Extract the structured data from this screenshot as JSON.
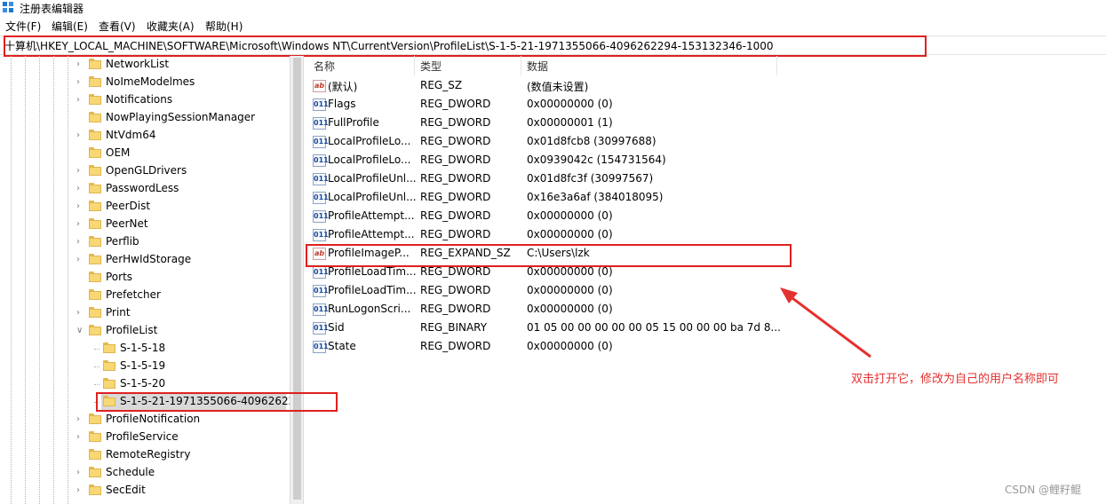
{
  "window": {
    "title": "注册表编辑器",
    "icon": "regedit-icon"
  },
  "menu": [
    "文件(F)",
    "编辑(E)",
    "查看(V)",
    "收藏夹(A)",
    "帮助(H)"
  ],
  "address": {
    "path": "十算机\\HKEY_LOCAL_MACHINE\\SOFTWARE\\Microsoft\\Windows NT\\CurrentVersion\\ProfileList\\S-1-5-21-1971355066-4096262294-153132346-1000"
  },
  "tree": {
    "items": [
      {
        "label": "NetworkList",
        "expandable": true
      },
      {
        "label": "NoImeModelmes",
        "expandable": true
      },
      {
        "label": "Notifications",
        "expandable": true
      },
      {
        "label": "NowPlayingSessionManager",
        "expandable": false
      },
      {
        "label": "NtVdm64",
        "expandable": true
      },
      {
        "label": "OEM",
        "expandable": false
      },
      {
        "label": "OpenGLDrivers",
        "expandable": true
      },
      {
        "label": "PasswordLess",
        "expandable": true
      },
      {
        "label": "PeerDist",
        "expandable": true
      },
      {
        "label": "PeerNet",
        "expandable": true
      },
      {
        "label": "Perflib",
        "expandable": true
      },
      {
        "label": "PerHwIdStorage",
        "expandable": true
      },
      {
        "label": "Ports",
        "expandable": false
      },
      {
        "label": "Prefetcher",
        "expandable": false
      },
      {
        "label": "Print",
        "expandable": true
      },
      {
        "label": "ProfileList",
        "expandable": true,
        "expanded": true
      },
      {
        "label": "S-1-5-18",
        "child": true
      },
      {
        "label": "S-1-5-19",
        "child": true
      },
      {
        "label": "S-1-5-20",
        "child": true
      },
      {
        "label": "S-1-5-21-1971355066-40962622",
        "child": true,
        "selected": true
      },
      {
        "label": "ProfileNotification",
        "expandable": true
      },
      {
        "label": "ProfileService",
        "expandable": true
      },
      {
        "label": "RemoteRegistry",
        "expandable": false
      },
      {
        "label": "Schedule",
        "expandable": true
      },
      {
        "label": "SecEdit",
        "expandable": true
      }
    ]
  },
  "list": {
    "columns": [
      "名称",
      "类型",
      "数据"
    ],
    "rows": [
      {
        "icon": "string-value-icon",
        "name": "(默认)",
        "type": "REG_SZ",
        "data": "(数值未设置)"
      },
      {
        "icon": "binary-value-icon",
        "name": "Flags",
        "type": "REG_DWORD",
        "data": "0x00000000 (0)"
      },
      {
        "icon": "binary-value-icon",
        "name": "FullProfile",
        "type": "REG_DWORD",
        "data": "0x00000001 (1)"
      },
      {
        "icon": "binary-value-icon",
        "name": "LocalProfileLo...",
        "type": "REG_DWORD",
        "data": "0x01d8fcb8 (30997688)"
      },
      {
        "icon": "binary-value-icon",
        "name": "LocalProfileLo...",
        "type": "REG_DWORD",
        "data": "0x0939042c (154731564)"
      },
      {
        "icon": "binary-value-icon",
        "name": "LocalProfileUnl...",
        "type": "REG_DWORD",
        "data": "0x01d8fc3f (30997567)"
      },
      {
        "icon": "binary-value-icon",
        "name": "LocalProfileUnl...",
        "type": "REG_DWORD",
        "data": "0x16e3a6af (384018095)"
      },
      {
        "icon": "binary-value-icon",
        "name": "ProfileAttempt...",
        "type": "REG_DWORD",
        "data": "0x00000000 (0)"
      },
      {
        "icon": "binary-value-icon",
        "name": "ProfileAttempt...",
        "type": "REG_DWORD",
        "data": "0x00000000 (0)"
      },
      {
        "icon": "string-value-icon",
        "name": "ProfileImageP...",
        "type": "REG_EXPAND_SZ",
        "data": "C:\\Users\\lzk"
      },
      {
        "icon": "binary-value-icon",
        "name": "ProfileLoadTim...",
        "type": "REG_DWORD",
        "data": "0x00000000 (0)"
      },
      {
        "icon": "binary-value-icon",
        "name": "ProfileLoadTim...",
        "type": "REG_DWORD",
        "data": "0x00000000 (0)"
      },
      {
        "icon": "binary-value-icon",
        "name": "RunLogonScri...",
        "type": "REG_DWORD",
        "data": "0x00000000 (0)"
      },
      {
        "icon": "binary-value-icon",
        "name": "Sid",
        "type": "REG_BINARY",
        "data": "01 05 00 00 00 00 00 05 15 00 00 00 ba 7d 8..."
      },
      {
        "icon": "binary-value-icon",
        "name": "State",
        "type": "REG_DWORD",
        "data": "0x00000000 (0)"
      }
    ]
  },
  "annotation": {
    "text": "双击打开它，修改为自己的用户名称即可",
    "color": "#e53030"
  },
  "watermark": "CSDN @鲤籽鲲"
}
